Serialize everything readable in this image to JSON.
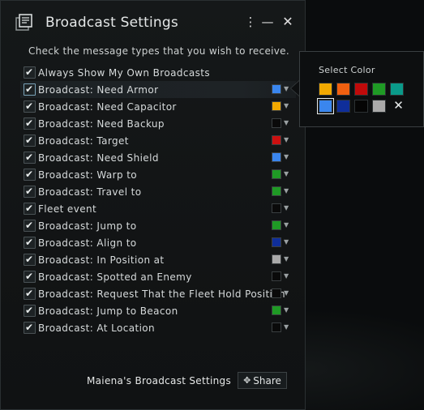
{
  "window": {
    "title": "Broadcast Settings",
    "menu_icon": "more-vertical-icon",
    "minimize_icon": "minimize-icon",
    "close_icon": "close-icon",
    "instructions": "Check the message types that you wish to receive."
  },
  "broadcasts": [
    {
      "label": "Always Show My Own Broadcasts",
      "checked": true,
      "color": null
    },
    {
      "label": "Broadcast: Need Armor",
      "checked": true,
      "color": "#3a86ee",
      "selected_row": true
    },
    {
      "label": "Broadcast: Need Capacitor",
      "checked": true,
      "color": "#f2a900"
    },
    {
      "label": "Broadcast: Need Backup",
      "checked": true,
      "color": "#0a0a0a"
    },
    {
      "label": "Broadcast: Target",
      "checked": true,
      "color": "#cc1010"
    },
    {
      "label": "Broadcast: Need Shield",
      "checked": true,
      "color": "#3a86ee"
    },
    {
      "label": "Broadcast: Warp to",
      "checked": true,
      "color": "#1f9a25"
    },
    {
      "label": "Broadcast: Travel to",
      "checked": true,
      "color": "#1f9a25"
    },
    {
      "label": "Fleet event",
      "checked": true,
      "color": "#0a0a0a"
    },
    {
      "label": "Broadcast: Jump to",
      "checked": true,
      "color": "#1f9a25"
    },
    {
      "label": "Broadcast: Align to",
      "checked": true,
      "color": "#0f2e9a"
    },
    {
      "label": "Broadcast: In Position at",
      "checked": true,
      "color": "#aaaaaa"
    },
    {
      "label": "Broadcast: Spotted an Enemy",
      "checked": true,
      "color": "#0a0a0a"
    },
    {
      "label": "Broadcast: Request That the Fleet Hold Position",
      "checked": true,
      "color": "#0a0a0a"
    },
    {
      "label": "Broadcast: Jump to Beacon",
      "checked": true,
      "color": "#1f9a25"
    },
    {
      "label": "Broadcast: At Location",
      "checked": true,
      "color": "#0a0a0a"
    }
  ],
  "footer": {
    "settings_name": "Maiena's Broadcast Settings",
    "share_label": "Share",
    "share_icon": "move-arrows-icon"
  },
  "color_picker": {
    "title": "Select Color",
    "colors": [
      "#f2a900",
      "#f06010",
      "#c00a0a",
      "#1f9a25",
      "#0a9a8a",
      "#3a86ee",
      "#0f2e9a",
      "#050505",
      "#aaaaaa"
    ],
    "selected_color": "#3a86ee",
    "clear_icon": "close-icon"
  }
}
